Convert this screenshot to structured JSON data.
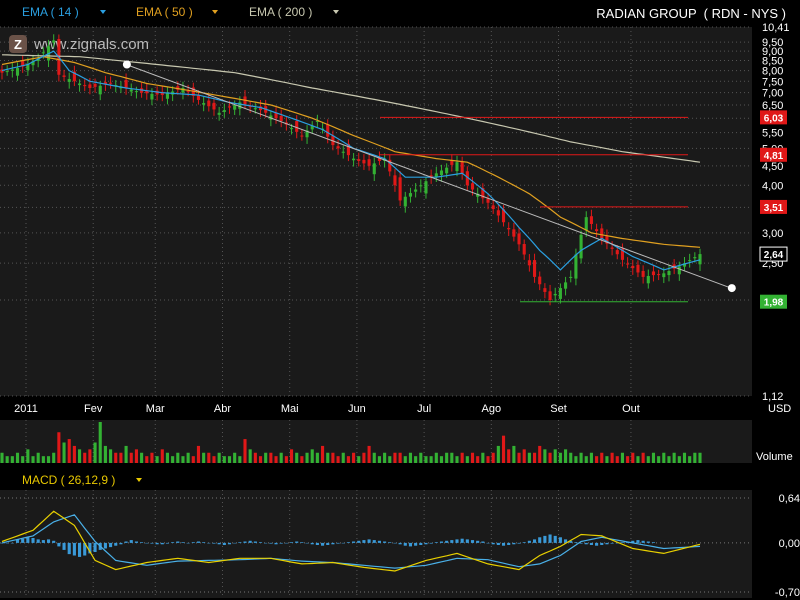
{
  "header": {
    "ema14_label": "EMA ( 14 )",
    "ema50_label": "EMA ( 50 )",
    "ema200_label": "EMA ( 200 )",
    "title": "RADIAN GROUP  ( RDN - NYS )",
    "watermark": "www.zignals.com",
    "logo_letter": "Z"
  },
  "colors": {
    "ema14": "#2a9fe0",
    "ema50": "#e0a020",
    "ema200": "#c8c8b0",
    "up": "#33b233",
    "down": "#e01818",
    "grid": "#555555",
    "panel_bg": "#1a1a1a"
  },
  "chart_data": [
    {
      "type": "candlestick",
      "title": "RADIAN GROUP  ( RDN - NYS )",
      "unit": "USD",
      "scale": "log",
      "ylim": [
        1.12,
        10.41
      ],
      "y_ticks": [
        "10,41",
        "9,50",
        "9,00",
        "8,50",
        "8,00",
        "7,50",
        "7,00",
        "6,50",
        "6,00",
        "5,50",
        "5,00",
        "4,50",
        "4,00",
        "3,50",
        "3,00",
        "2,50",
        "2,00",
        "1,12"
      ],
      "x_ticks": [
        "2011",
        "Fev",
        "Mar",
        "Abr",
        "Mai",
        "Jun",
        "Jul",
        "Ago",
        "Set",
        "Out"
      ],
      "x_label": "USD",
      "grid": true,
      "price_path": [
        [
          0,
          7.9
        ],
        [
          4,
          8.2
        ],
        [
          7,
          8.6
        ],
        [
          10,
          9.6
        ],
        [
          11,
          7.8
        ],
        [
          14,
          7.5
        ],
        [
          17,
          7.2
        ],
        [
          21,
          7.4
        ],
        [
          24,
          7.2
        ],
        [
          27,
          7.0
        ],
        [
          31,
          6.9
        ],
        [
          35,
          7.2
        ],
        [
          38,
          6.7
        ],
        [
          42,
          6.2
        ],
        [
          46,
          6.6
        ],
        [
          50,
          6.3
        ],
        [
          54,
          5.9
        ],
        [
          58,
          5.4
        ],
        [
          61,
          5.9
        ],
        [
          64,
          5.1
        ],
        [
          68,
          4.7
        ],
        [
          71,
          4.5
        ],
        [
          74,
          4.7
        ],
        [
          77,
          3.65
        ],
        [
          80,
          3.9
        ],
        [
          84,
          4.3
        ],
        [
          88,
          4.6
        ],
        [
          90,
          4.0
        ],
        [
          94,
          3.6
        ],
        [
          97,
          3.2
        ],
        [
          100,
          2.8
        ],
        [
          103,
          2.3
        ],
        [
          106,
          2.0
        ],
        [
          110,
          2.3
        ],
        [
          113,
          3.3
        ],
        [
          116,
          2.9
        ],
        [
          120,
          2.55
        ],
        [
          124,
          2.3
        ],
        [
          128,
          2.35
        ],
        [
          131,
          2.45
        ],
        [
          135,
          2.64
        ]
      ],
      "ema14_path": [
        [
          0,
          8.0
        ],
        [
          5,
          8.3
        ],
        [
          10,
          9.0
        ],
        [
          13,
          8.0
        ],
        [
          17,
          7.5
        ],
        [
          24,
          7.2
        ],
        [
          31,
          7.0
        ],
        [
          38,
          6.9
        ],
        [
          44,
          6.6
        ],
        [
          50,
          6.4
        ],
        [
          56,
          6.0
        ],
        [
          62,
          5.6
        ],
        [
          68,
          5.0
        ],
        [
          74,
          4.7
        ],
        [
          78,
          4.2
        ],
        [
          84,
          4.2
        ],
        [
          89,
          4.3
        ],
        [
          94,
          3.8
        ],
        [
          100,
          3.1
        ],
        [
          104,
          2.7
        ],
        [
          108,
          2.4
        ],
        [
          112,
          2.7
        ],
        [
          116,
          2.9
        ],
        [
          122,
          2.6
        ],
        [
          128,
          2.4
        ],
        [
          135,
          2.55
        ]
      ],
      "ema50_path": [
        [
          0,
          8.3
        ],
        [
          8,
          8.7
        ],
        [
          14,
          8.4
        ],
        [
          20,
          7.9
        ],
        [
          28,
          7.4
        ],
        [
          36,
          7.1
        ],
        [
          44,
          6.8
        ],
        [
          52,
          6.5
        ],
        [
          60,
          6.0
        ],
        [
          68,
          5.4
        ],
        [
          76,
          4.9
        ],
        [
          84,
          4.7
        ],
        [
          90,
          4.6
        ],
        [
          96,
          4.2
        ],
        [
          102,
          3.8
        ],
        [
          108,
          3.3
        ],
        [
          114,
          3.0
        ],
        [
          120,
          2.9
        ],
        [
          128,
          2.8
        ],
        [
          135,
          2.75
        ]
      ],
      "ema200_path": [
        [
          0,
          8.8
        ],
        [
          15,
          8.7
        ],
        [
          30,
          8.3
        ],
        [
          45,
          7.9
        ],
        [
          60,
          7.2
        ],
        [
          75,
          6.6
        ],
        [
          90,
          6.0
        ],
        [
          100,
          5.6
        ],
        [
          110,
          5.2
        ],
        [
          120,
          4.9
        ],
        [
          135,
          4.6
        ]
      ],
      "trend_line": {
        "from": [
          24,
          8.3
        ],
        "to": [
          141,
          2.15
        ]
      },
      "horizontal_levels": [
        {
          "value": 6.03,
          "label": "6,03",
          "color": "#e01818"
        },
        {
          "value": 4.81,
          "label": "4,81",
          "color": "#e01818"
        },
        {
          "value": 3.51,
          "label": "3,51",
          "color": "#e01818"
        },
        {
          "value": 2.64,
          "label": "2,64",
          "color": "#000000"
        },
        {
          "value": 1.98,
          "label": "1,98",
          "color": "#33b233"
        }
      ]
    },
    {
      "type": "bar",
      "title": "Volume",
      "values": [
        3,
        2,
        2,
        3,
        2,
        4,
        2,
        3,
        2,
        2,
        3,
        9,
        6,
        7,
        5,
        4,
        3,
        4,
        6,
        12,
        5,
        4,
        3,
        3,
        5,
        3,
        4,
        3,
        2,
        3,
        2,
        4,
        3,
        2,
        3,
        2,
        3,
        2,
        5,
        3,
        3,
        2,
        3,
        2,
        2,
        3,
        2,
        7,
        4,
        3,
        2,
        3,
        3,
        2,
        3,
        2,
        4,
        3,
        2,
        3,
        4,
        3,
        5,
        3,
        3,
        2,
        3,
        2,
        3,
        2,
        3,
        5,
        3,
        2,
        3,
        2,
        3,
        3,
        2,
        3,
        2,
        3,
        2,
        2,
        3,
        2,
        3,
        3,
        2,
        3,
        2,
        3,
        2,
        3,
        2,
        3,
        5,
        8,
        4,
        5,
        3,
        4,
        3,
        3,
        5,
        4,
        3,
        4,
        3,
        4,
        3,
        2,
        3,
        2,
        3,
        2,
        3,
        2,
        3,
        2,
        3,
        2,
        3,
        2,
        3,
        2,
        3,
        2,
        3,
        2,
        3,
        2,
        3,
        2,
        3,
        3
      ]
    },
    {
      "type": "line",
      "title": "MACD ( 26,12,9 )",
      "y_ticks": [
        "0,64",
        "0,00",
        "-0,70"
      ],
      "ylim": [
        -0.7,
        0.64
      ],
      "macd_path": [
        [
          0,
          0.02
        ],
        [
          6,
          0.18
        ],
        [
          10,
          0.45
        ],
        [
          14,
          0.25
        ],
        [
          18,
          -0.25
        ],
        [
          22,
          -0.38
        ],
        [
          28,
          -0.28
        ],
        [
          34,
          -0.22
        ],
        [
          40,
          -0.28
        ],
        [
          46,
          -0.22
        ],
        [
          52,
          -0.22
        ],
        [
          58,
          -0.3
        ],
        [
          64,
          -0.28
        ],
        [
          70,
          -0.35
        ],
        [
          76,
          -0.4
        ],
        [
          82,
          -0.25
        ],
        [
          88,
          -0.15
        ],
        [
          94,
          -0.3
        ],
        [
          100,
          -0.38
        ],
        [
          104,
          -0.18
        ],
        [
          108,
          -0.05
        ],
        [
          112,
          0.12
        ],
        [
          116,
          0.1
        ],
        [
          122,
          -0.08
        ],
        [
          128,
          -0.15
        ],
        [
          135,
          -0.02
        ]
      ],
      "signal_path": [
        [
          0,
          0.0
        ],
        [
          6,
          0.1
        ],
        [
          10,
          0.3
        ],
        [
          14,
          0.4
        ],
        [
          18,
          0.02
        ],
        [
          22,
          -0.25
        ],
        [
          28,
          -0.32
        ],
        [
          34,
          -0.26
        ],
        [
          40,
          -0.25
        ],
        [
          46,
          -0.24
        ],
        [
          52,
          -0.22
        ],
        [
          58,
          -0.26
        ],
        [
          64,
          -0.28
        ],
        [
          70,
          -0.32
        ],
        [
          76,
          -0.36
        ],
        [
          82,
          -0.32
        ],
        [
          88,
          -0.22
        ],
        [
          94,
          -0.24
        ],
        [
          100,
          -0.34
        ],
        [
          104,
          -0.3
        ],
        [
          108,
          -0.18
        ],
        [
          112,
          0.02
        ],
        [
          116,
          0.08
        ],
        [
          122,
          0.0
        ],
        [
          128,
          -0.08
        ],
        [
          135,
          -0.05
        ]
      ],
      "histogram": [
        0,
        0,
        0,
        0.05,
        0.06,
        0.08,
        0.07,
        0.05,
        0.04,
        0.05,
        0.03,
        -0.05,
        -0.1,
        -0.16,
        -0.18,
        -0.2,
        -0.18,
        -0.15,
        -0.13,
        -0.1,
        -0.08,
        -0.06,
        -0.04,
        -0.02,
        0.02,
        0.04,
        0.02,
        0.01,
        0,
        -0.01,
        -0.02,
        -0.02,
        -0.01,
        0.01,
        0.02,
        0.01,
        0,
        0.01,
        0.02,
        0.01,
        0,
        -0.01,
        -0.02,
        -0.03,
        -0.02,
        0,
        0.01,
        0.02,
        0.03,
        0.02,
        0.01,
        0,
        -0.01,
        -0.02,
        -0.01,
        0,
        0.01,
        0.02,
        0.01,
        0,
        -0.02,
        -0.03,
        -0.04,
        -0.03,
        -0.02,
        -0.01,
        0,
        0.01,
        0.02,
        0.03,
        0.04,
        0.05,
        0.04,
        0.03,
        0.02,
        0.01,
        0,
        -0.02,
        -0.04,
        -0.05,
        -0.04,
        -0.03,
        -0.02,
        -0.01,
        0.01,
        0.02,
        0.03,
        0.04,
        0.05,
        0.06,
        0.05,
        0.04,
        0.03,
        0.02,
        0,
        -0.02,
        -0.03,
        -0.04,
        -0.03,
        -0.02,
        -0.01,
        0.01,
        0.03,
        0.05,
        0.08,
        0.1,
        0.12,
        0.1,
        0.08,
        0.05,
        0.03,
        0.01,
        -0.01,
        -0.02,
        -0.03,
        -0.04,
        -0.03,
        -0.02,
        -0.01,
        0,
        0.01,
        0.02,
        0.03,
        0.04,
        0.03,
        0.02,
        0.01
      ]
    }
  ]
}
